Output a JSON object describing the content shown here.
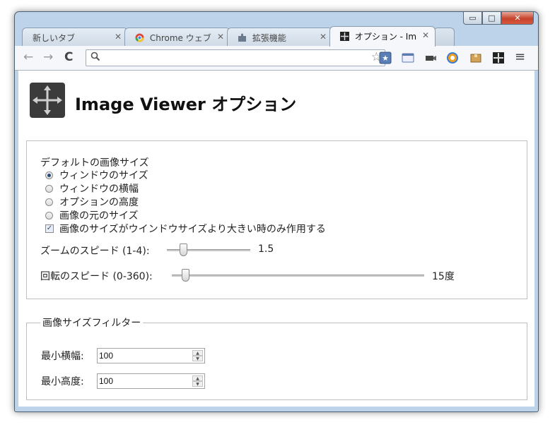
{
  "window": {
    "caption_buttons": {
      "minimize": "▭",
      "maximize": "□",
      "close": "✕"
    }
  },
  "tabs": [
    {
      "label": "新しいタブ",
      "icon": "none"
    },
    {
      "label": "Chrome ウェブ",
      "icon": "chrome-icon"
    },
    {
      "label": "拡張機能",
      "icon": "puzzle-icon"
    },
    {
      "label": "オプション - Im",
      "icon": "image-viewer-icon",
      "active": true
    }
  ],
  "toolbar": {
    "back": "←",
    "forward": "→",
    "reload": "C",
    "omnibox_value": "",
    "search_glyph": "🔍",
    "bookmark_glyph": "☆",
    "menu_glyph": "≡"
  },
  "page": {
    "title": "Image Viewer オプション"
  },
  "default_size": {
    "heading": "デフォルトの画像サイズ",
    "options": [
      {
        "label": "ウィンドウのサイズ",
        "checked": true
      },
      {
        "label": "ウィンドウの横幅",
        "checked": false
      },
      {
        "label": "オプションの高度",
        "checked": false
      },
      {
        "label": "画像の元のサイズ",
        "checked": false
      }
    ],
    "only_larger_label": "画像のサイズがウインドウサイズより大きい時のみ作用する",
    "only_larger_checked": true
  },
  "zoom_speed": {
    "label": "ズームのスピード (1-4):",
    "value": "1.5",
    "fraction": 0.17
  },
  "rotate_speed": {
    "label": "回転のスピード (0-360):",
    "value": "15度",
    "fraction": 0.04
  },
  "filter": {
    "legend": "画像サイズフィルター",
    "min_width_label": "最小横幅:",
    "min_width_value": "100",
    "min_height_label": "最小高度:",
    "min_height_value": "100"
  }
}
